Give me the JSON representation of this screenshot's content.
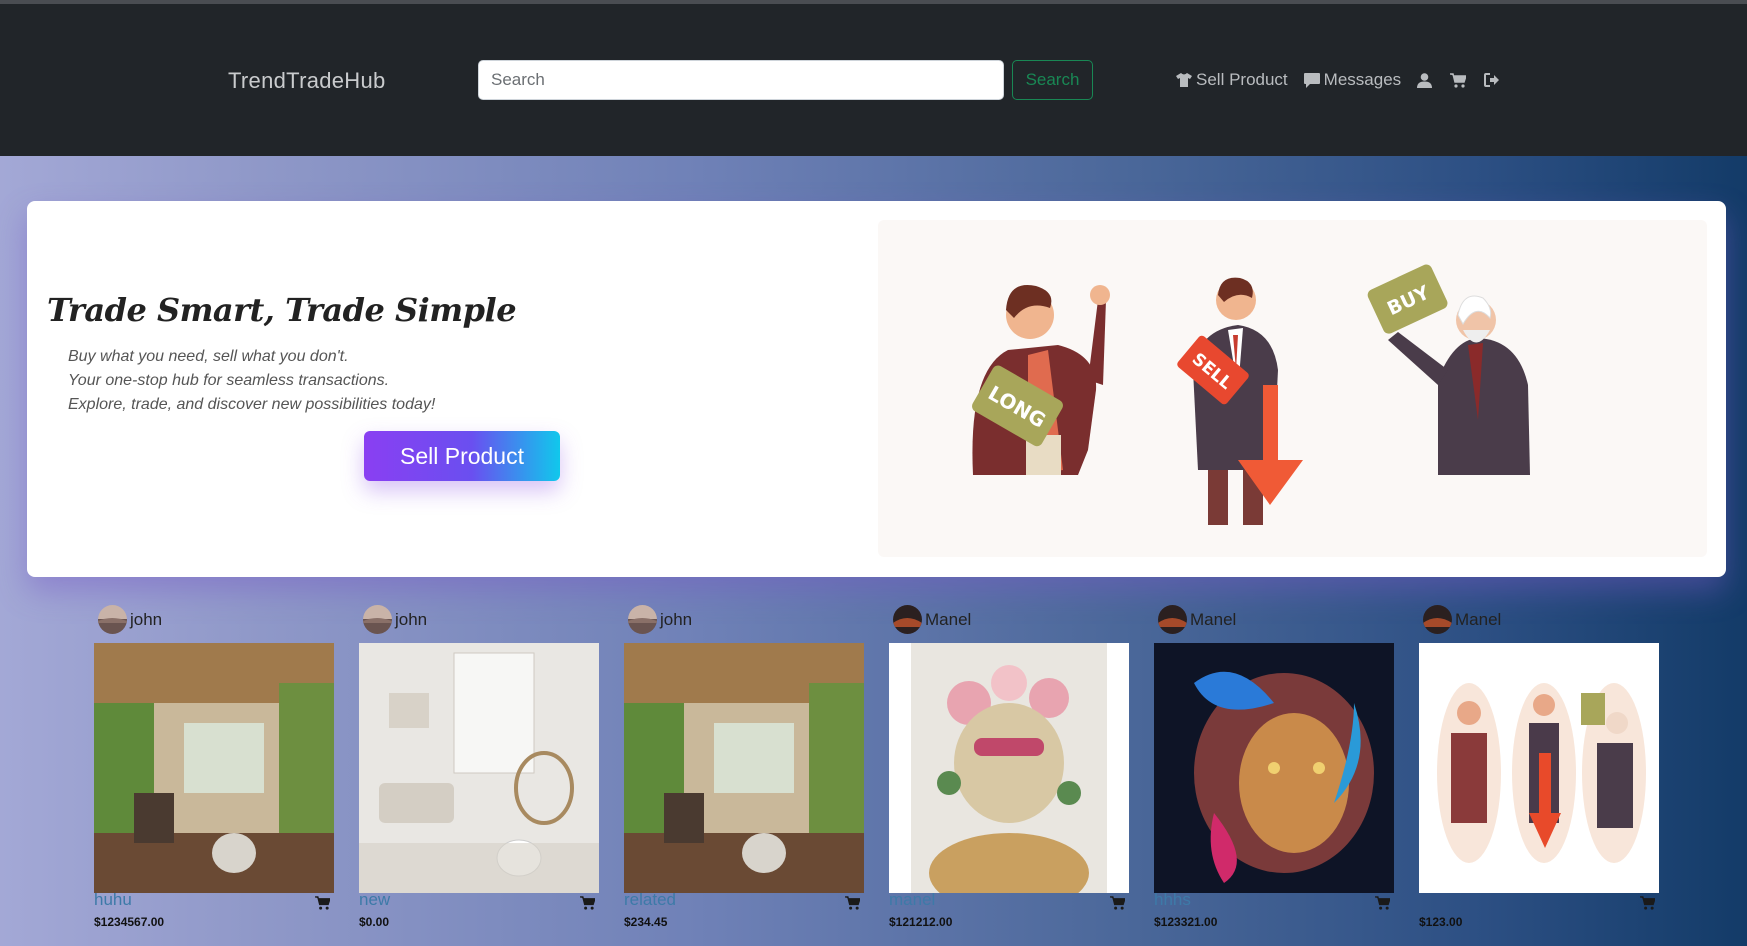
{
  "navbar": {
    "brand": "TrendTradeHub",
    "search_placeholder": "Search",
    "search_button": "Search",
    "sell_product": "Sell Product",
    "messages": "Messages",
    "icons": [
      "shirt-icon",
      "message-icon",
      "user-icon",
      "cart-icon",
      "logout-icon"
    ]
  },
  "hero": {
    "title": "Trade Smart, Trade Simple",
    "lines": [
      "Buy what you need, sell what you don't.",
      "Your one-stop hub for seamless transactions.",
      "Explore, trade, and discover new possibilities today!"
    ],
    "button": "Sell Product",
    "illustration_labels": [
      "LONG",
      "SELL",
      "BUY"
    ]
  },
  "products": [
    {
      "seller": "john",
      "name": "huhu",
      "price": "$1234567.00",
      "image": "loft-interior"
    },
    {
      "seller": "john",
      "name": "new",
      "price": "$0.00",
      "image": "living-room"
    },
    {
      "seller": "john",
      "name": "related",
      "price": "$234.45",
      "image": "loft-interior"
    },
    {
      "seller": "Manel",
      "name": "manel",
      "price": "$121212.00",
      "image": "floral-leopard"
    },
    {
      "seller": "Manel",
      "name": "hhhs",
      "price": "$123321.00",
      "image": "neon-lion"
    },
    {
      "seller": "Manel",
      "name": "",
      "price": "$123.00",
      "image": "traders-illustration"
    }
  ],
  "colors": {
    "navbar_bg": "#212529",
    "search_accent": "#198754",
    "button_gradient_start": "#8a3ff2",
    "button_gradient_end": "#10c8ec",
    "product_name": "#3d7aa8"
  }
}
